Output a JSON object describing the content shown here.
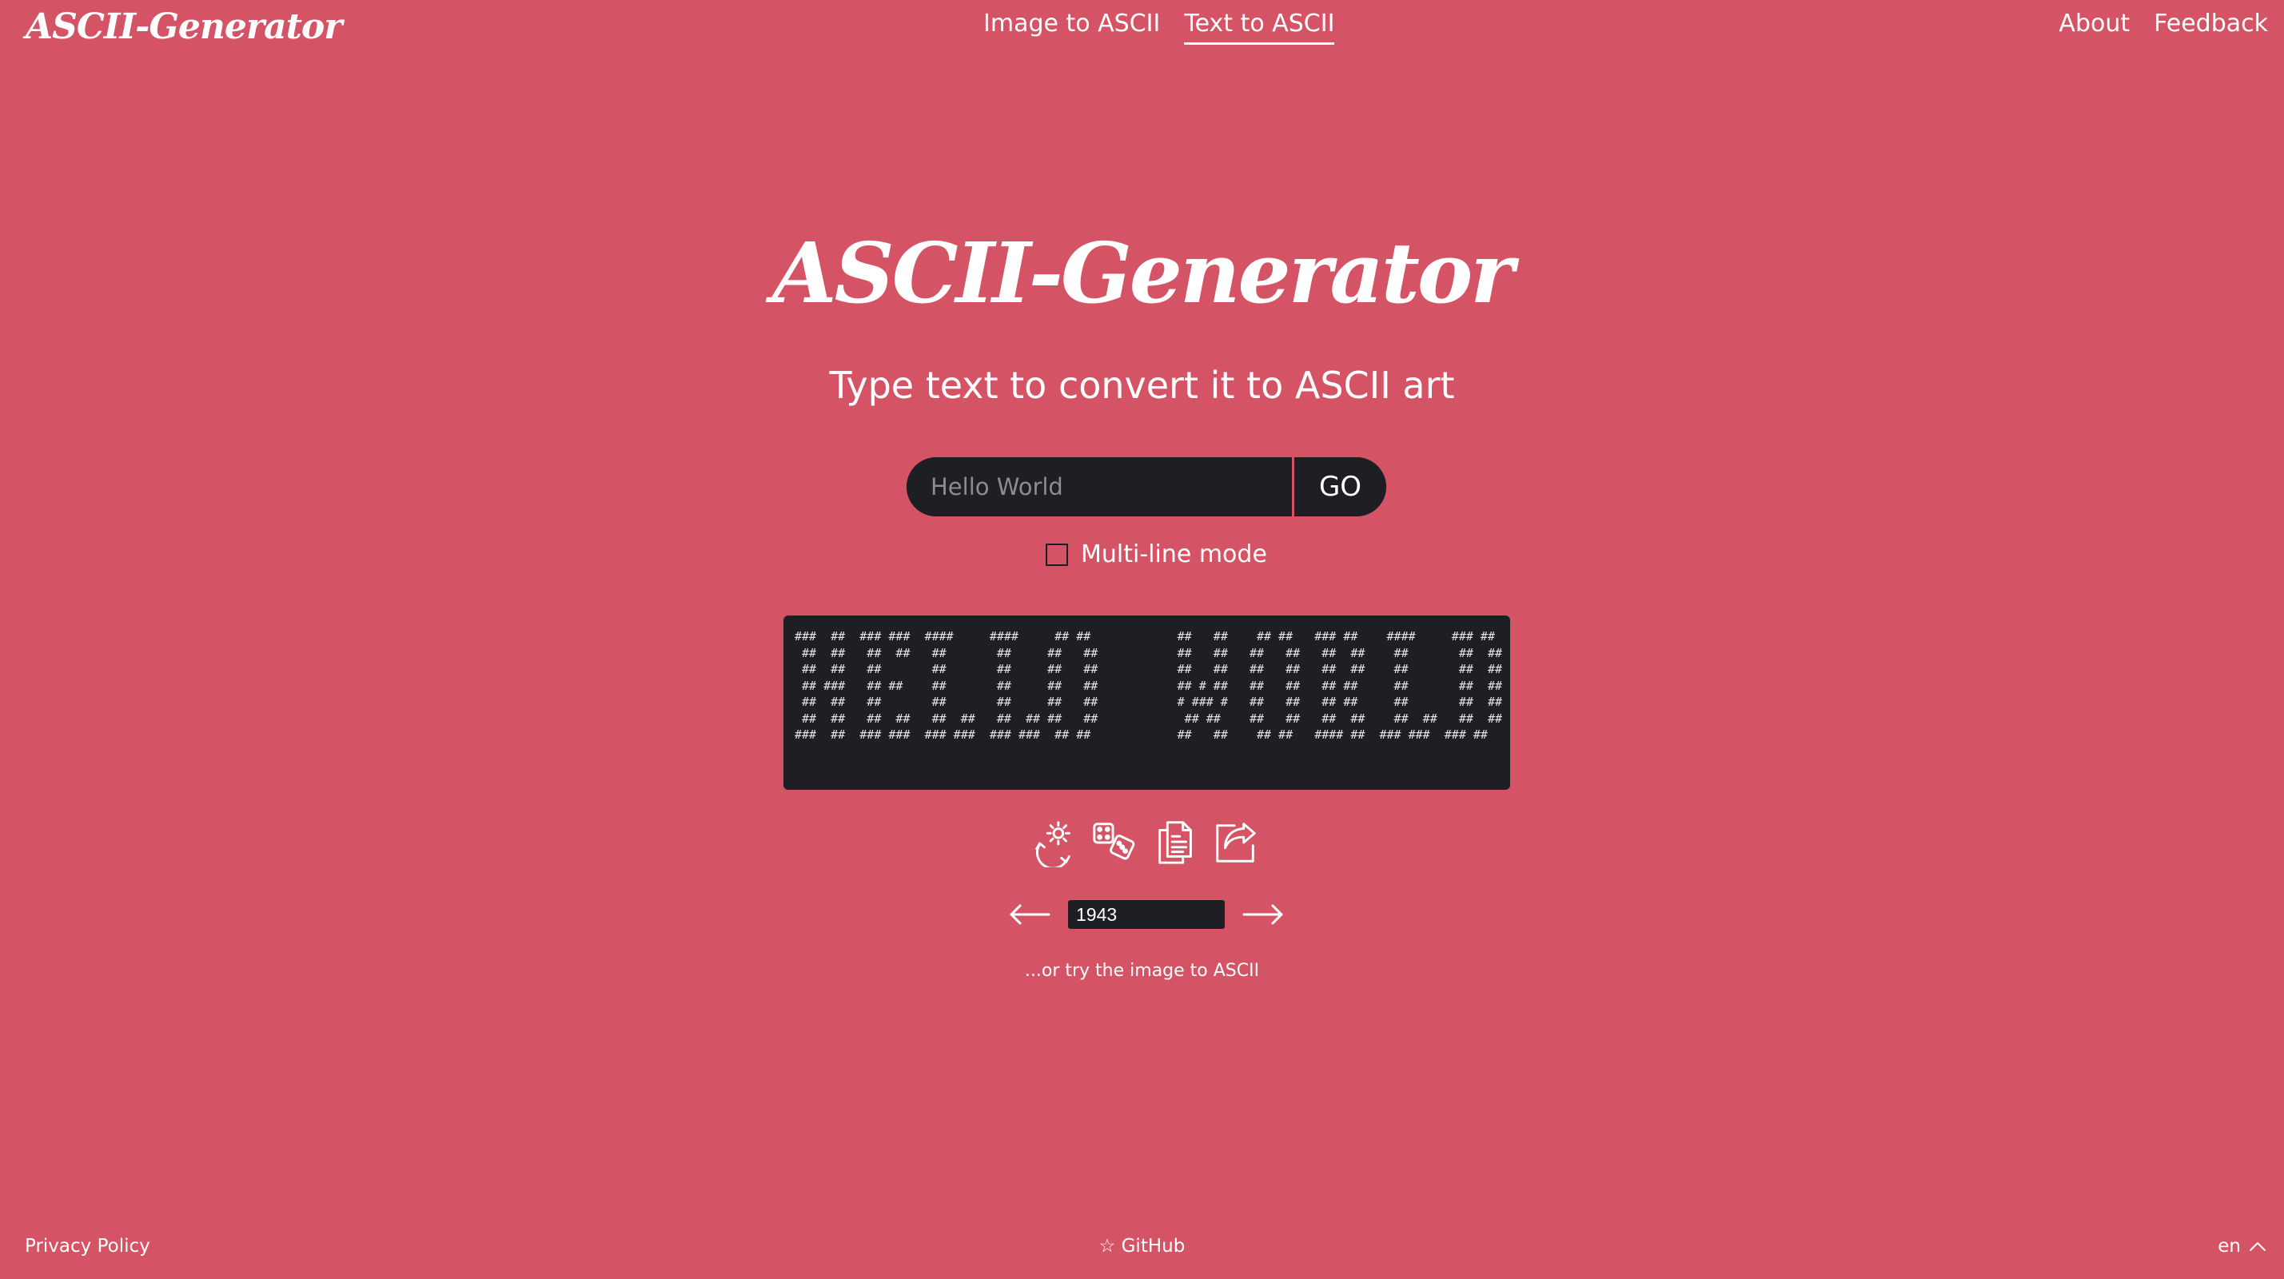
{
  "nav": {
    "logo": "ASCII-Generator",
    "links": [
      "Image to ASCII",
      "Text to ASCII"
    ],
    "active_link": "Text to ASCII",
    "right_links": [
      "About",
      "Feedback"
    ]
  },
  "hero": {
    "title": "ASCII-Generator",
    "subtitle": "Type text to convert it to ASCII art"
  },
  "input": {
    "placeholder": "Hello World",
    "value": "",
    "go_label": "GO"
  },
  "multiline": {
    "label": "Multi-line mode",
    "checked": false
  },
  "output": {
    "ascii": "###  ##  ### ###  ####     ####     ## ##            ##   ##    ## ##   ### ##    ####     ### ##\n ##  ##   ##  ##   ##       ##     ##   ##           ##   ##   ##   ##   ##  ##    ##       ##  ##\n ##  ##   ##       ##       ##     ##   ##           ##   ##   ##   ##   ##  ##    ##       ##  ##\n ## ###   ## ##    ##       ##     ##   ##           ## # ##   ##   ##   ## ##     ##       ##  ##\n ##  ##   ##       ##       ##     ##   ##           # ### #   ##   ##   ## ##     ##       ##  ##\n ##  ##   ##  ##   ##  ##   ##  ## ##   ##            ## ##    ##   ##   ##  ##    ##  ##   ##  ##\n###  ##  ### ###  ### ###  ### ###  ## ##            ##   ##    ## ##   #### ##  ### ###  ### ##"
  },
  "actions": [
    {
      "name": "settings-icon",
      "title": "Options"
    },
    {
      "name": "dice-icon",
      "title": "Random font"
    },
    {
      "name": "copy-icon",
      "title": "Copy"
    },
    {
      "name": "share-icon",
      "title": "Share"
    }
  ],
  "font_selector": {
    "value": "1943"
  },
  "links": {
    "try_image": "...or try the image to ASCII"
  },
  "footer": {
    "privacy": "Privacy Policy",
    "github": "☆ GitHub",
    "language": "en"
  },
  "colors": {
    "background": "#d45465",
    "dark": "#1e1f24",
    "text": "#ffffff"
  }
}
